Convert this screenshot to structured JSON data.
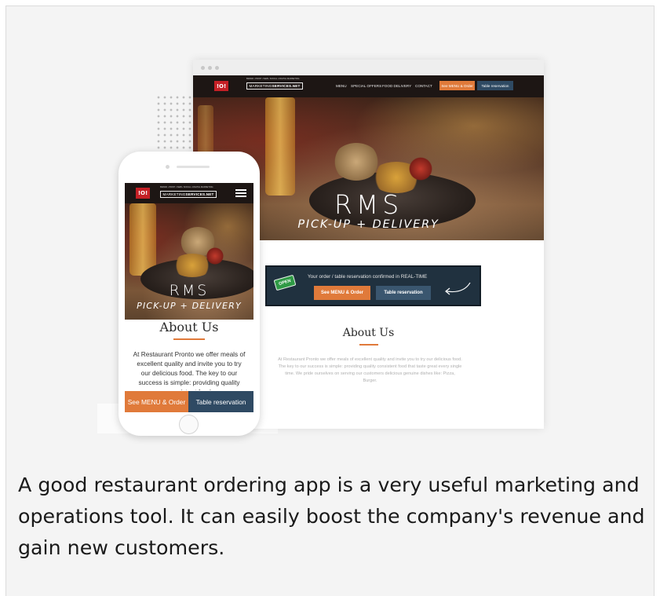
{
  "logo": {
    "mark": "!O!",
    "brand_regular": "MARKETING",
    "brand_bold": "SERVICES.NET",
    "tagline": "BRAND • PRINT • WEB • SOCIAL • DIGITAL MARKETING"
  },
  "desktop": {
    "nav_links": [
      "MENU",
      "SPECIAL OFFERS",
      "FOOD DELIVERY",
      "CONTACT"
    ],
    "nav_menu_button": "See MENU & Order",
    "nav_reserve_button": "Table reservation",
    "hero_title": "RMS",
    "hero_subtitle": "PICK-UP + DELIVERY",
    "open_sign": "OPEN",
    "order_text": "Your order / table reservation confirmed in REAL-TIME",
    "order_menu_button": "See MENU & Order",
    "order_reserve_button": "Table reservation",
    "about_title": "About Us",
    "about_text": "At Restaurant Pronto we offer meals of excellent quality and invite you to try our delicious food.  The key to our success is simple: providing quality consistent food that taste great every single time. We pride ourselves on serving our customers delicious genuine dishes like: Pizza, Burger."
  },
  "mobile": {
    "hero_title": "RMS",
    "hero_subtitle": "PICK-UP + DELIVERY",
    "about_title": "About Us",
    "about_text": "At Restaurant Pronto we offer meals of excellent quality and invite you to try our delicious food.  The key to our success is simple: providing quality consistent food",
    "menu_button": "See MENU & Order",
    "reserve_button": "Table reservation"
  },
  "caption": "A good restaurant ordering app is a very useful marketing and operations tool. It can easily boost the company's revenue and gain new customers.",
  "colors": {
    "brand_red": "#c52026",
    "accent_orange": "#e07a3a",
    "navy": "#2f4a63",
    "order_box": "#20313f",
    "open_green": "#2f9a45"
  },
  "icons": [
    "hamburger-menu-icon",
    "curved-arrow-icon",
    "open-sign-icon"
  ]
}
